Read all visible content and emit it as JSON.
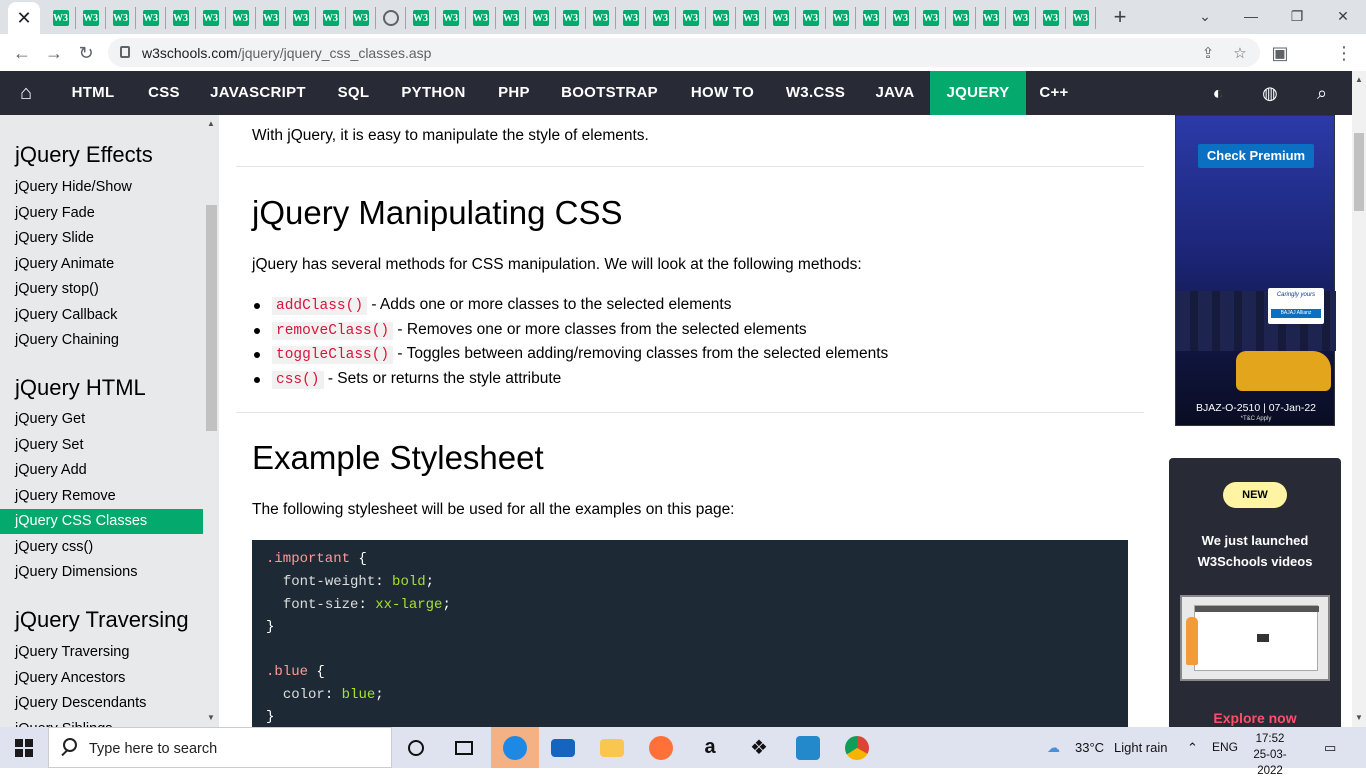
{
  "browser": {
    "active_tab_close": "✕",
    "tab_favicon": "W3",
    "new_tab": "+",
    "window_controls": [
      "⌄",
      "—",
      "❐",
      "✕"
    ],
    "url_host": "w3schools.com",
    "url_path": "/jquery/jquery_css_classes.asp"
  },
  "topnav": {
    "links": [
      "HTML",
      "CSS",
      "JAVASCRIPT",
      "SQL",
      "PYTHON",
      "PHP",
      "BOOTSTRAP",
      "HOW TO",
      "W3.CSS",
      "JAVA",
      "JQUERY",
      "C++"
    ],
    "active": "JQUERY",
    "icons": [
      "home-icon",
      "contrast-icon",
      "globe-icon",
      "search-icon"
    ]
  },
  "sidebar": {
    "effects_title": "jQuery Effects",
    "effects": [
      "jQuery Hide/Show",
      "jQuery Fade",
      "jQuery Slide",
      "jQuery Animate",
      "jQuery stop()",
      "jQuery Callback",
      "jQuery Chaining"
    ],
    "html_title": "jQuery HTML",
    "html": [
      "jQuery Get",
      "jQuery Set",
      "jQuery Add",
      "jQuery Remove",
      "jQuery CSS Classes",
      "jQuery css()",
      "jQuery Dimensions"
    ],
    "traversing_title": "jQuery Traversing",
    "traversing": [
      "jQuery Traversing",
      "jQuery Ancestors",
      "jQuery Descendants",
      "jQuery Siblings"
    ],
    "active_item": "jQuery CSS Classes"
  },
  "main": {
    "intro": "With jQuery, it is easy to manipulate the style of elements.",
    "h1": "jQuery Manipulating CSS",
    "methods_intro": "jQuery has several methods for CSS manipulation. We will look at the following methods:",
    "methods": [
      {
        "code": "addClass()",
        "desc": " - Adds one or more classes to the selected elements"
      },
      {
        "code": "removeClass()",
        "desc": " - Removes one or more classes from the selected elements"
      },
      {
        "code": "toggleClass()",
        "desc": " - Toggles between adding/removing classes from the selected elements"
      },
      {
        "code": "css()",
        "desc": " - Sets or returns the style attribute"
      }
    ],
    "h2": "Example Stylesheet",
    "stylesheet_intro": "The following stylesheet will be used for all the examples on this page:",
    "code": {
      "sel1": ".important",
      "brace_open": " {",
      "p1": "font-weight",
      "v1": "bold",
      "p2": "font-size",
      "v2": "xx-large",
      "brace_close": "}",
      "sel2": ".blue",
      "p3": "color",
      "v3": "blue"
    }
  },
  "ad": {
    "check_premium": "Check Premium",
    "card_text": "Caringly yours",
    "card_brand": "BAJAJ Allianz",
    "fine_print": "BJAZ-O-2510 | 07-Jan-22",
    "tc": "*T&C Apply"
  },
  "promo": {
    "badge": "NEW",
    "headline_1": "We just launched",
    "headline_2": "W3Schools videos",
    "cta": "Explore now"
  },
  "taskbar": {
    "search_placeholder": "Type here to search",
    "temperature": "33°C",
    "weather": "Light rain",
    "lang": "ENG",
    "time": "17:52",
    "date": "25-03-2022"
  },
  "colors": {
    "accent": "#04aa6d",
    "nav_bg": "#282a35",
    "code_bg": "#1d2a35",
    "inline_code": "#dc143c"
  }
}
